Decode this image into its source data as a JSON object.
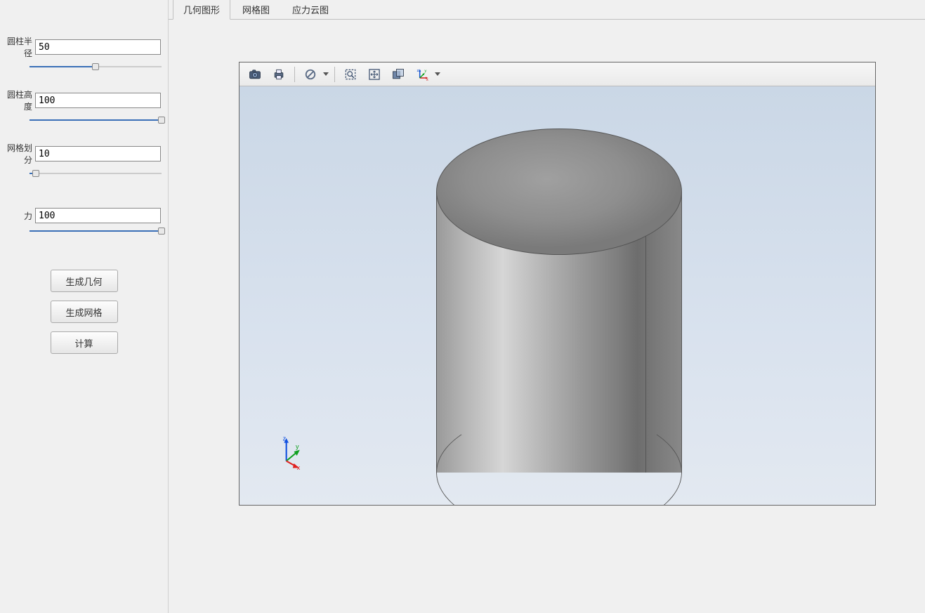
{
  "sidebar": {
    "params": [
      {
        "label": "圆柱半径",
        "value": "50",
        "slider_pct": 50
      },
      {
        "label": "圆柱高度",
        "value": "100",
        "slider_pct": 100
      },
      {
        "label": "网格划分",
        "value": "10",
        "slider_pct": 5
      },
      {
        "label": "力",
        "value": "100",
        "slider_pct": 100,
        "label_align_right": true
      }
    ],
    "buttons": {
      "gen_geometry": "生成几何",
      "gen_mesh": "生成网格",
      "compute": "计算"
    }
  },
  "tabs": [
    {
      "label": "几何图形",
      "active": true
    },
    {
      "label": "网格图",
      "active": false
    },
    {
      "label": "应力云图",
      "active": false
    }
  ],
  "toolbar": {
    "icons": {
      "camera": "camera-icon",
      "print": "print-icon",
      "nosign": "no-sign-icon",
      "rubberband": "rubber-band-zoom-icon",
      "fit": "fit-to-window-icon",
      "transparency": "transparency-icon",
      "axes": "axes-orientation-icon"
    }
  },
  "triad": {
    "x": "x",
    "y": "y",
    "z": "z"
  }
}
